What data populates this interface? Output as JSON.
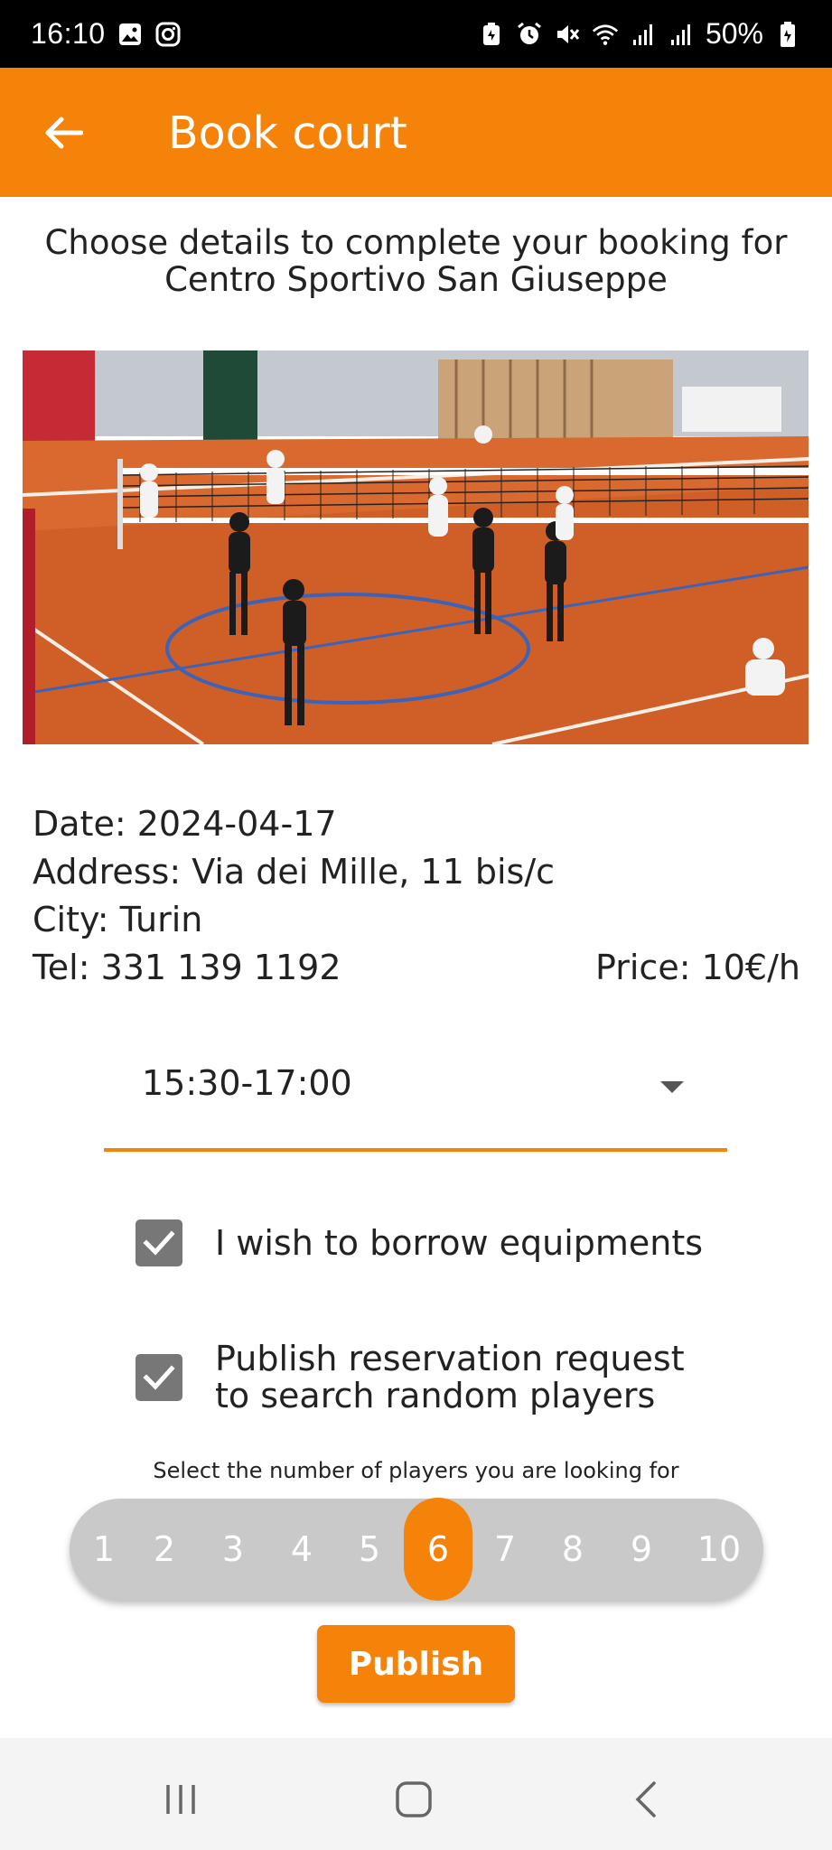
{
  "status_bar": {
    "time": "16:10",
    "battery": "50%",
    "icons": [
      "gallery-icon",
      "instagram-icon",
      "battery-saver-icon",
      "alarm-icon",
      "mute-icon",
      "wifi-icon",
      "signal-icon",
      "signal-icon-2",
      "battery-icon"
    ]
  },
  "app_bar": {
    "title": "Book court",
    "back_icon": "arrow-back-icon",
    "color": "#f5830a"
  },
  "intro": {
    "line1": "Choose details to complete your booking for",
    "line2": "Centro Sportivo  San Giuseppe"
  },
  "details": {
    "date": "Date: 2024-04-17",
    "address": "Address: Via dei Mille, 11 bis/c",
    "city": "City: Turin",
    "tel": "Tel: 331 139 1192",
    "price": "Price: 10€/h"
  },
  "time_slot": {
    "selected": "15:30-17:00"
  },
  "options": {
    "borrow_equipment": {
      "label": "I wish to borrow equipments",
      "checked": true
    },
    "publish_request": {
      "label_line1": "Publish reservation request",
      "label_line2": "to search random players",
      "checked": true
    }
  },
  "players": {
    "caption": "Select the number of players you are looking for",
    "numbers": [
      "1",
      "2",
      "3",
      "4",
      "5",
      "6",
      "7",
      "8",
      "9",
      "10"
    ],
    "selected": "6"
  },
  "publish_button": {
    "label": "Publish"
  },
  "nav_bar": {
    "icons": [
      "recents-icon",
      "home-icon",
      "back-icon"
    ]
  }
}
